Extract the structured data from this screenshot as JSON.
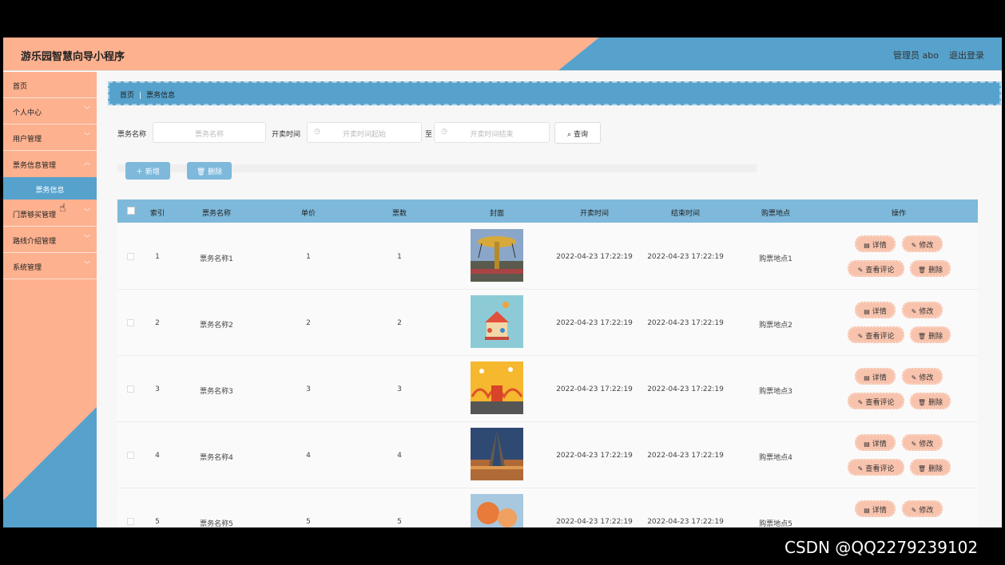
{
  "header": {
    "app_title": "游乐园智慧向导小程序",
    "admin": "管理员 abo",
    "logout": "退出登录"
  },
  "sidebar": {
    "items": [
      {
        "label": "首页"
      },
      {
        "label": "个人中心"
      },
      {
        "label": "用户管理"
      },
      {
        "label": "票务信息管理"
      },
      {
        "label": "门票够买管理"
      },
      {
        "label": "路线介绍管理"
      },
      {
        "label": "系统管理"
      }
    ],
    "sub_item": "票务信息"
  },
  "breadcrumb": {
    "home": "首页",
    "current": "票务信息"
  },
  "search": {
    "name_label": "票务名称",
    "name_placeholder": "票务名称",
    "time_label": "开卖时间",
    "start_placeholder": "开卖时间起始",
    "to_label": "至",
    "end_placeholder": "开卖时间结束",
    "query_button": "查询"
  },
  "actions": {
    "add": "新增",
    "delete": "删除"
  },
  "table": {
    "headers": [
      "索引",
      "票务名称",
      "单价",
      "票数",
      "封面",
      "开卖时间",
      "结束时间",
      "购票地点",
      "操作"
    ],
    "row_buttons": {
      "detail": "详情",
      "edit": "修改",
      "comments": "查看评论",
      "delete": "删除"
    },
    "rows": [
      {
        "index": "1",
        "name": "票务名称1",
        "price": "1",
        "count": "1",
        "start": "2022-04-23 17:22:19",
        "end": "2022-04-23 17:22:19",
        "place": "购票地点1"
      },
      {
        "index": "2",
        "name": "票务名称2",
        "price": "2",
        "count": "2",
        "start": "2022-04-23 17:22:19",
        "end": "2022-04-23 17:22:19",
        "place": "购票地点2"
      },
      {
        "index": "3",
        "name": "票务名称3",
        "price": "3",
        "count": "3",
        "start": "2022-04-23 17:22:19",
        "end": "2022-04-23 17:22:19",
        "place": "购票地点3"
      },
      {
        "index": "4",
        "name": "票务名称4",
        "price": "4",
        "count": "4",
        "start": "2022-04-23 17:22:19",
        "end": "2022-04-23 17:22:19",
        "place": "购票地点4"
      },
      {
        "index": "5",
        "name": "票务名称5",
        "price": "5",
        "count": "5",
        "start": "2022-04-23 17:22:19",
        "end": "2022-04-23 17:22:19",
        "place": "购票地点5"
      }
    ]
  },
  "watermark": "CSDN @QQ2279239102",
  "colors": {
    "peach": "#fdb18f",
    "blue": "#56a2cd",
    "light_blue": "#7eb9db",
    "button_pink": "#f8c3ad"
  }
}
